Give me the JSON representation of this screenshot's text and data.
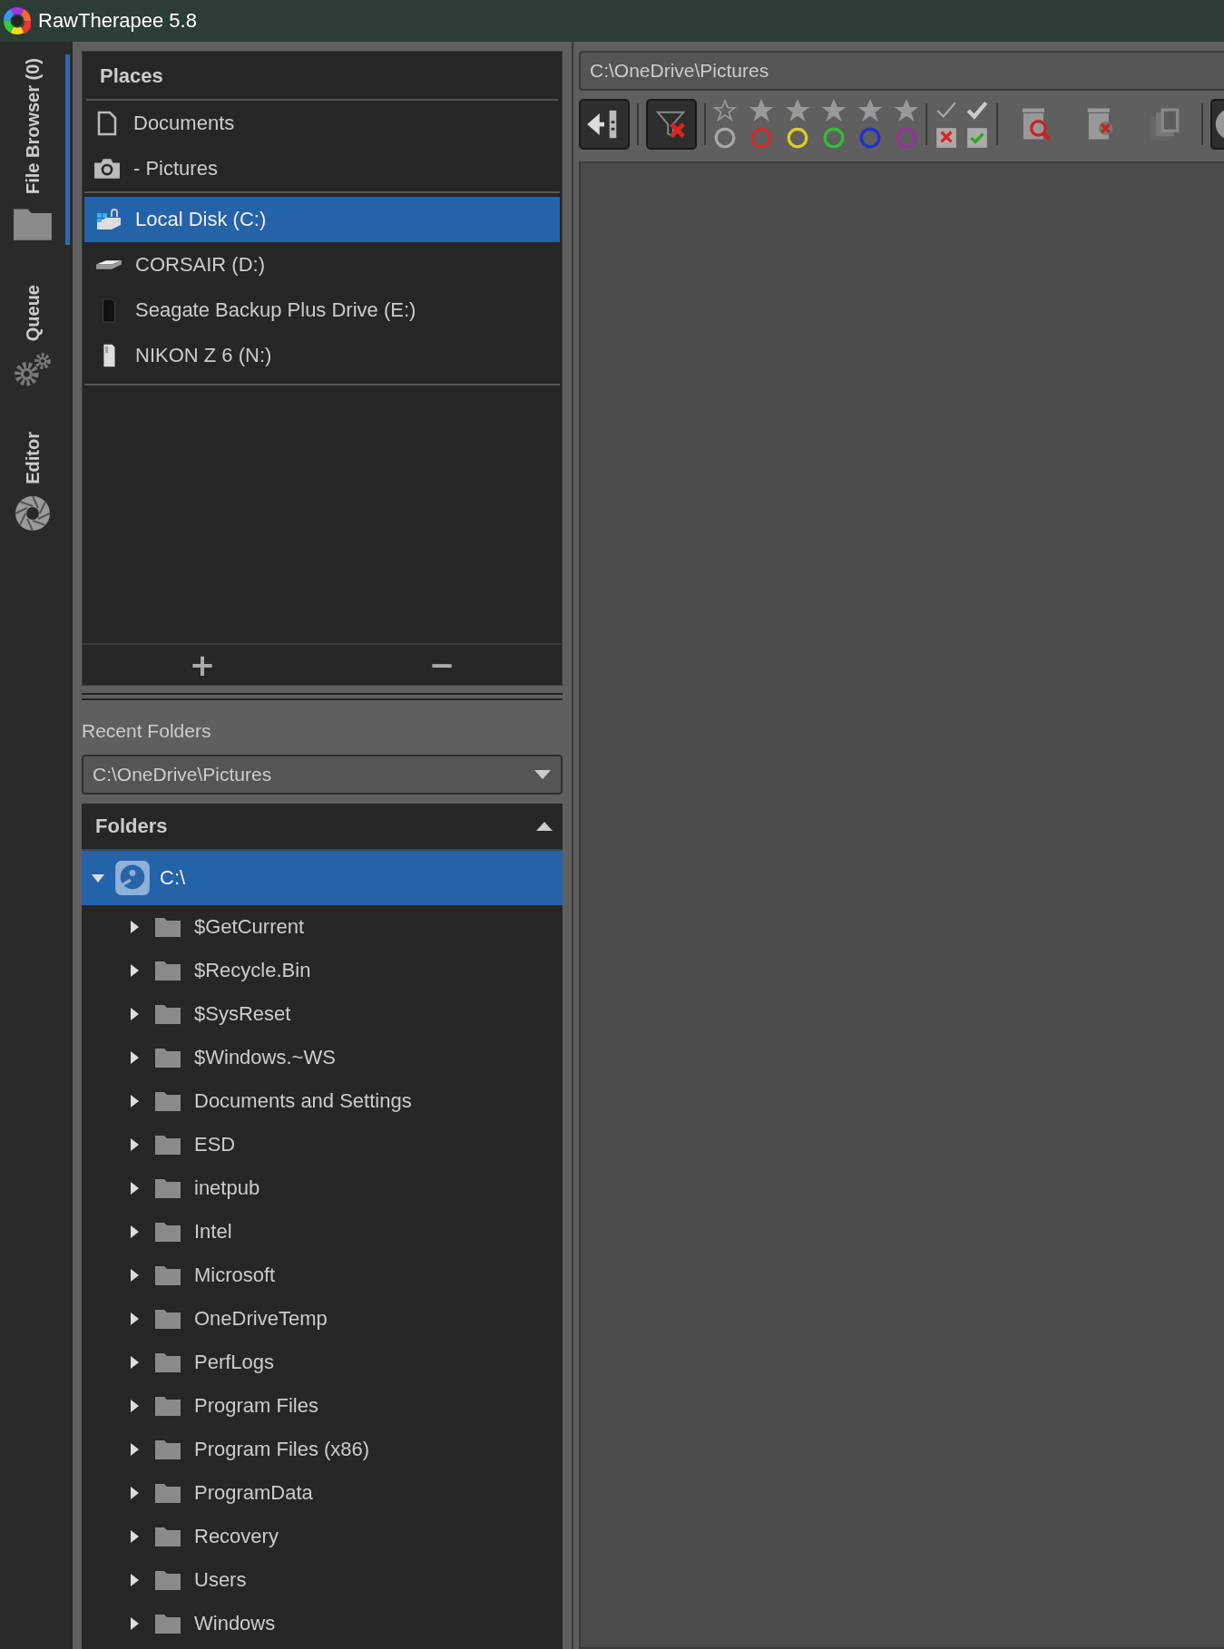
{
  "window": {
    "title": "RawTherapee 5.8"
  },
  "side_tabs": [
    {
      "label": "File Browser (0)",
      "kind": "browser",
      "selected": true
    },
    {
      "label": "Queue",
      "kind": "queue",
      "selected": false
    },
    {
      "label": "Editor",
      "kind": "editor",
      "selected": false
    }
  ],
  "places": {
    "title": "Places",
    "shortcuts": [
      {
        "label": "Documents",
        "kind": "document",
        "selected": false
      },
      {
        "label": "- Pictures",
        "kind": "camera",
        "selected": false
      }
    ],
    "drives": [
      {
        "label": "Local Disk (C:)",
        "kind": "system-disk",
        "selected": true
      },
      {
        "label": "CORSAIR (D:)",
        "kind": "flat-drive",
        "selected": false
      },
      {
        "label": "Seagate Backup Plus Drive (E:)",
        "kind": "tower-drive",
        "selected": false
      },
      {
        "label": "NIKON Z 6 (N:)",
        "kind": "card",
        "selected": false
      }
    ],
    "add": "+",
    "remove": "−"
  },
  "recent": {
    "label": "Recent Folders",
    "value": "C:\\OneDrive\\Pictures"
  },
  "folders": {
    "title": "Folders",
    "expanded": true,
    "tree": [
      {
        "label": "C:\\",
        "selected": true,
        "expanded": true,
        "children": [
          {
            "label": "$GetCurrent",
            "selected": false,
            "expanded": false
          },
          {
            "label": "$Recycle.Bin",
            "selected": false,
            "expanded": false
          },
          {
            "label": "$SysReset",
            "selected": false,
            "expanded": false
          },
          {
            "label": "$Windows.~WS",
            "selected": false,
            "expanded": false
          },
          {
            "label": "Documents and Settings",
            "selected": false,
            "expanded": false
          },
          {
            "label": "ESD",
            "selected": false,
            "expanded": false
          },
          {
            "label": "inetpub",
            "selected": false,
            "expanded": false
          },
          {
            "label": "Intel",
            "selected": false,
            "expanded": false
          },
          {
            "label": "Microsoft",
            "selected": false,
            "expanded": false
          },
          {
            "label": "OneDriveTemp",
            "selected": false,
            "expanded": false
          },
          {
            "label": "PerfLogs",
            "selected": false,
            "expanded": false
          },
          {
            "label": "Program Files",
            "selected": false,
            "expanded": false
          },
          {
            "label": "Program Files (x86)",
            "selected": false,
            "expanded": false
          },
          {
            "label": "ProgramData",
            "selected": false,
            "expanded": false
          },
          {
            "label": "Recovery",
            "selected": false,
            "expanded": false
          },
          {
            "label": "Users",
            "selected": false,
            "expanded": false
          },
          {
            "label": "Windows",
            "selected": false,
            "expanded": false
          }
        ]
      }
    ]
  },
  "path": {
    "value": "C:\\OneDrive\\Pictures"
  },
  "toolbar": {
    "color_labels": [
      {
        "color": "#a8a8a8"
      },
      {
        "color": "#d42a2a"
      },
      {
        "color": "#d8d020"
      },
      {
        "color": "#30c030"
      },
      {
        "color": "#2030d0"
      },
      {
        "color": "#9a309a"
      }
    ]
  }
}
